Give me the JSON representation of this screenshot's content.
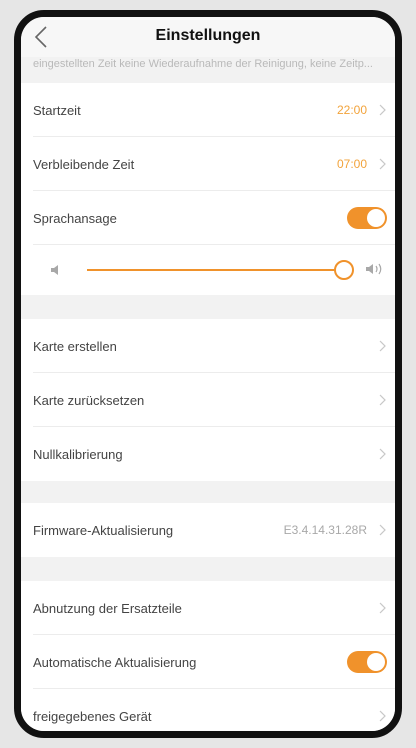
{
  "header": {
    "title": "Einstellungen"
  },
  "notice": "eingestellten Zeit keine Wiederaufnahme der Reinigung, keine Zeitp...",
  "schedule": {
    "start_label": "Startzeit",
    "start_value": "22:00",
    "remaining_label": "Verbleibende Zeit",
    "remaining_value": "07:00"
  },
  "voice": {
    "label": "Sprachansage",
    "enabled": true,
    "volume_fraction": 1.0
  },
  "map": {
    "create_label": "Karte erstellen",
    "reset_label": "Karte zurücksetzen",
    "calibration_label": "Nullkalibrierung"
  },
  "firmware": {
    "label": "Firmware-Aktualisierung",
    "version": "E3.4.14.31.28R"
  },
  "misc": {
    "wear_label": "Abnutzung der Ersatzteile",
    "auto_update_label": "Automatische Aktualisierung",
    "auto_update_enabled": true,
    "shared_device_label": "freigegebenes Gerät"
  },
  "colors": {
    "accent": "#f0922b"
  }
}
